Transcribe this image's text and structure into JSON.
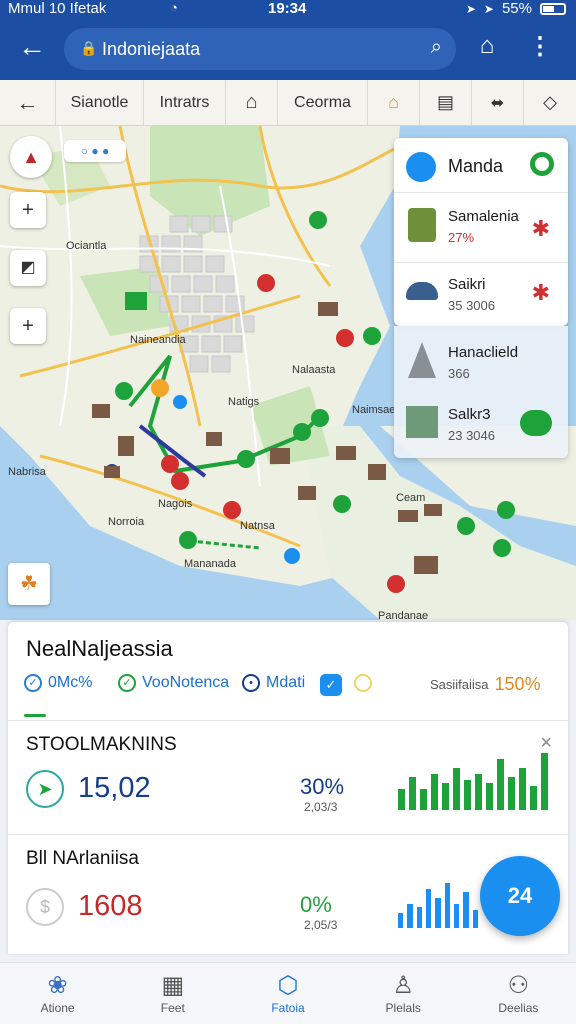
{
  "status_bar": {
    "left": "Mmul 10 Ifetak",
    "time": "19:34",
    "battery": "55%",
    "battery_level": 0.55
  },
  "app_bar": {
    "search_text": "Indoniejaata"
  },
  "filter_bar": {
    "items": [
      {
        "label": "",
        "icon": "back-arrow-icon"
      },
      {
        "label": "Sianotle"
      },
      {
        "label": "Intratrs"
      },
      {
        "label": "",
        "icon": "home-icon"
      },
      {
        "label": "Ceorma"
      },
      {
        "label": "",
        "icon": "house-orange-icon"
      },
      {
        "label": "",
        "icon": "grid-doc-icon"
      },
      {
        "label": "",
        "icon": "split-icon"
      },
      {
        "label": "",
        "icon": "pin-diamond-icon"
      }
    ]
  },
  "map": {
    "labels": [
      "Ociantla",
      "Natigs",
      "Naineandia",
      "Nalaasta",
      "Naimsae",
      "Nabrisa",
      "Norroia",
      "Nagois",
      "Natnsa",
      "Mananada",
      "Pandanae",
      "Ceam"
    ],
    "badge_icon": "clover-icon"
  },
  "side_card": {
    "title": "Manda",
    "items": [
      {
        "name": "Samalenia",
        "sub": "27%",
        "sub_color": "#d32f2f"
      },
      {
        "name": "Saikri",
        "sub": "35 3006"
      }
    ],
    "lower_items": [
      {
        "name": "Hanaclield",
        "sub": "366"
      },
      {
        "name": "Salkr3",
        "sub": "23 3046"
      }
    ]
  },
  "sheet": {
    "title": "NealNaljeassia",
    "chips": [
      {
        "label": "0Mc%",
        "icon": "circle-check-icon"
      },
      {
        "label": "VooNotenca",
        "icon": "check-icon"
      },
      {
        "label": "Mdati",
        "icon": "circle-icon"
      },
      {
        "label": "",
        "icon": "checkbox-icon"
      },
      {
        "label": "",
        "icon": "ring-icon"
      }
    ],
    "chip_right_label": "Sasiifaiisa",
    "chip_right_value": "150%",
    "stats": [
      {
        "title": "STOOLMAKNINS",
        "value": "15,02",
        "value_color": "#163d8a",
        "pct": "30%",
        "subpct": "2,03/3",
        "pct_color": "#163d8a",
        "bar_color": "#1ea33a",
        "bars": [
          0.35,
          0.55,
          0.35,
          0.6,
          0.45,
          0.7,
          0.5,
          0.6,
          0.45,
          0.85,
          0.55,
          0.7,
          0.4,
          0.95
        ]
      },
      {
        "title": "Bll NArlaniisa",
        "value": "1608",
        "value_color": "#c62828",
        "pct": "0%",
        "subpct": "2,05/3",
        "pct_color": "#1ea33a",
        "bar_color": "#1a8ff0",
        "bars": [
          0.25,
          0.4,
          0.35,
          0.65,
          0.5,
          0.75,
          0.4,
          0.6,
          0.3
        ]
      }
    ]
  },
  "fab_label": "24",
  "bottom_nav": [
    {
      "label": "Atione",
      "icon": "flower-icon"
    },
    {
      "label": "Feet",
      "icon": "building-icon"
    },
    {
      "label": "Fatoia",
      "icon": "hexagon-icon",
      "active": true
    },
    {
      "label": "Plelals",
      "icon": "person-icon"
    },
    {
      "label": "Deelias",
      "icon": "share-icon"
    }
  ]
}
